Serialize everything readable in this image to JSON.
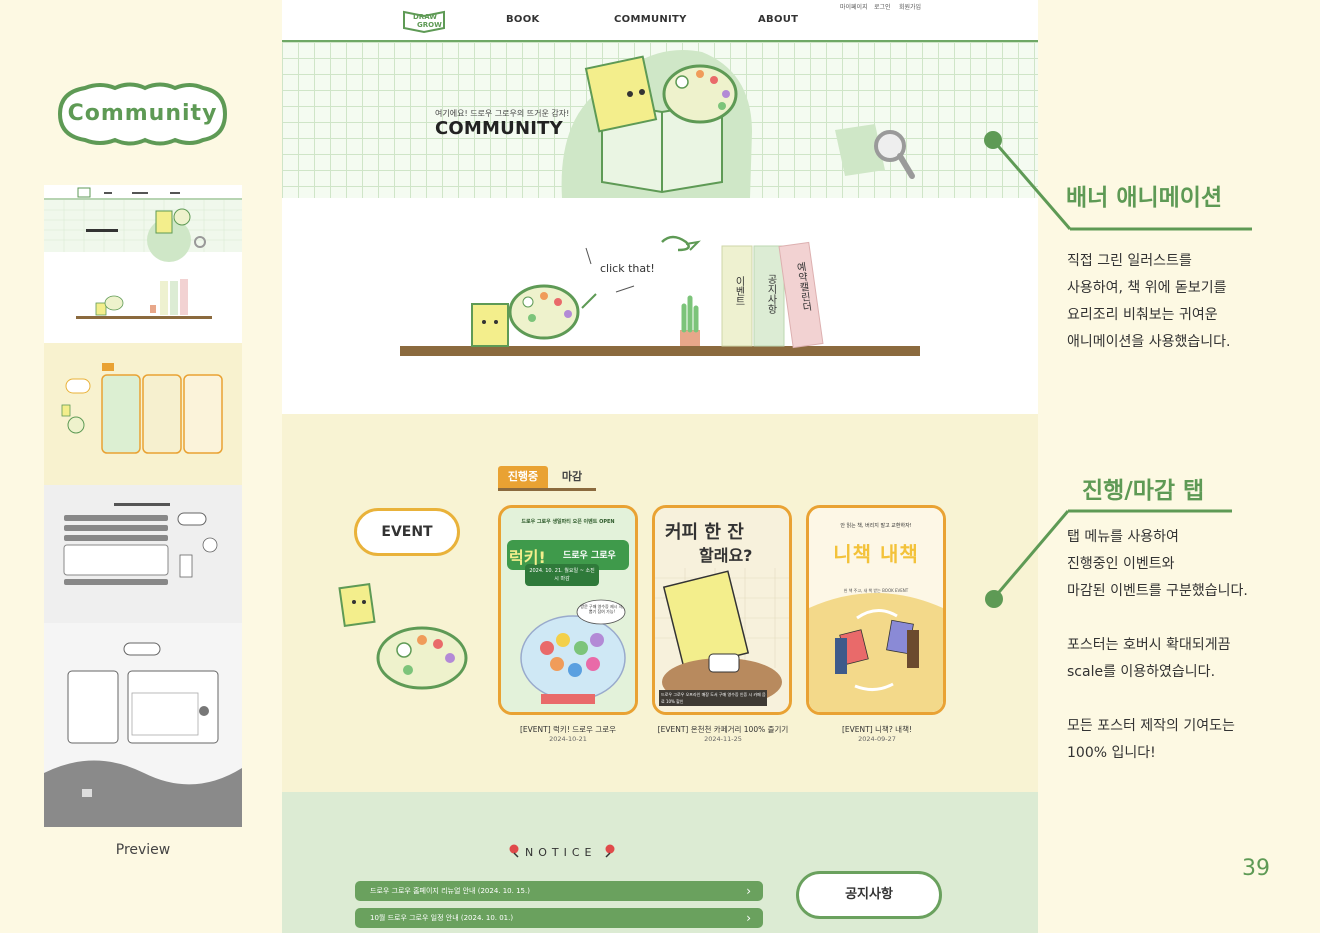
{
  "left": {
    "badge_label": "Community",
    "preview_caption": "Preview"
  },
  "site": {
    "logo_text_top": "DRAW",
    "logo_text_bottom": "GROW",
    "nav": [
      "BOOK",
      "COMMUNITY",
      "ABOUT"
    ],
    "util_links": [
      "마이페이지",
      "로그인",
      "회원가입"
    ],
    "banner_subtitle": "여기에요! 드로우 그로우의 뜨거운 감자!",
    "banner_title": "COMMUNITY",
    "click_text": "click that!",
    "shelf_books": [
      "이벤트",
      "공지사항",
      "예약캘린더"
    ],
    "tabs": [
      "진행중",
      "마감"
    ],
    "event_label": "EVENT",
    "posters": [
      {
        "top_text": "드로우 그로우 생일파티 오픈 이벤트 OPEN",
        "headline1": "럭키!",
        "headline2": "드로우 그로우",
        "date_box": "2024. 10. 21. 월요일 ~ 소진 시 마감",
        "bubble": "방문 구매 영수증 제시 시, 뽑기 참여 가능!",
        "caption": "[EVENT] 럭키! 드로우 그로우",
        "date": "2024-10-21"
      },
      {
        "headline1": "커피 한 잔",
        "headline2": "할래요?",
        "bottom_text": "드로우 그로우 오프라인 매장 도서 구매 영수증 인증 시 카페 음료 10% 할인",
        "caption": "[EVENT] 온천천 카페거리 100% 즐기기",
        "date": "2024-11-25"
      },
      {
        "top_text": "안 읽는 책, 버리지 말고 교환하자!",
        "headline": "니책 내책",
        "sub_text": "헌 책 주고, 새 책 받는 BOOK EVENT",
        "caption": "[EVENT] 니책? 내책!",
        "date": "2024-09-27"
      }
    ],
    "notice_title": "NOTICE",
    "notices": [
      "드로우 그로우 홈페이지 리뉴얼 안내 (2024. 10. 15.)",
      "10월 드로우 그로우 일정 안내 (2024. 10. 01.)"
    ],
    "notice_button": "공지사항"
  },
  "annotations": [
    {
      "title": "배너 애니메이션",
      "lines": [
        "직접 그린 일러스트를",
        "사용하여, 책 위에 돋보기를",
        "요리조리 비춰보는 귀여운",
        "애니메이션을 사용했습니다."
      ]
    },
    {
      "title": "진행/마감 탭",
      "lines": [
        "탭 메뉴를 사용하여",
        "진행중인 이벤트와",
        "마감된 이벤트를 구분했습니다.",
        "",
        "포스터는 호버시 확대되게끔",
        "scale를 이용하였습니다.",
        "",
        "모든 포스터 제작의 기여도는",
        "100% 입니다!"
      ]
    }
  ],
  "page_number": "39",
  "colors": {
    "accent_green": "#5e9a55",
    "event_orange": "#e9a233",
    "bg_cream": "#fdf9e3"
  }
}
